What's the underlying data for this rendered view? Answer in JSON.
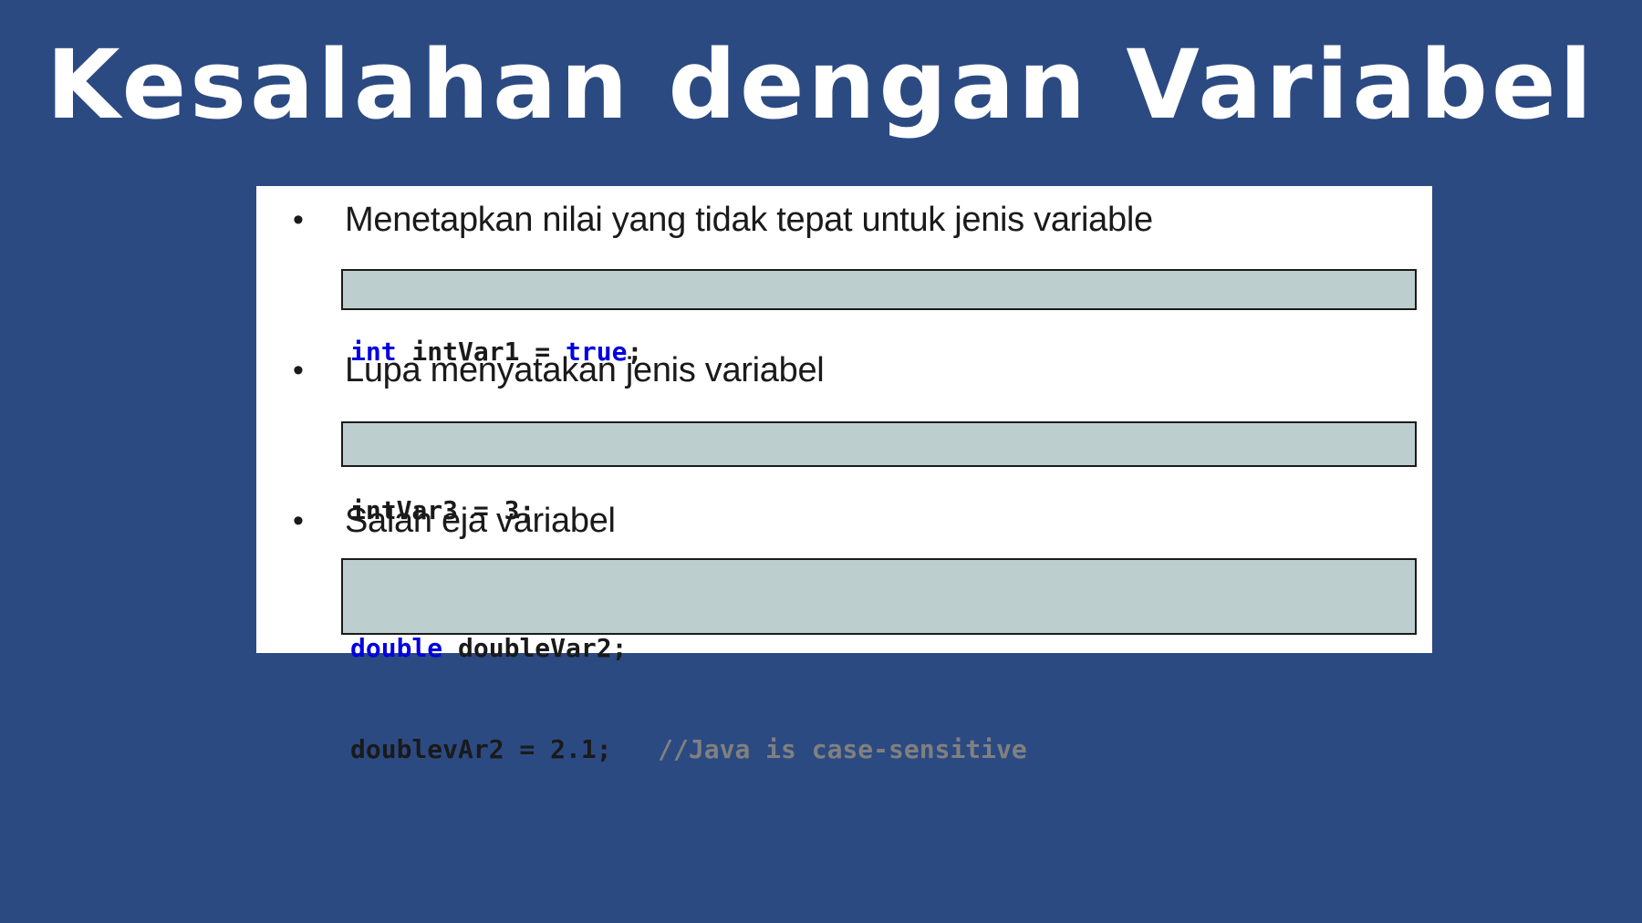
{
  "slide": {
    "title": "Kesalahan dengan Variabel"
  },
  "bullets": [
    {
      "marker": "•",
      "text": "Menetapkan nilai yang tidak tepat untuk jenis variable",
      "code": [
        [
          {
            "text": "int",
            "kind": "keyword"
          },
          {
            "text": " intVar1 = ",
            "kind": "plain"
          },
          {
            "text": "true",
            "kind": "keyword"
          },
          {
            "text": ";",
            "kind": "plain"
          }
        ]
      ]
    },
    {
      "marker": "•",
      "text": "Lupa menyatakan jenis variabel",
      "code": [
        [
          {
            "text": "intVar3 = 3;",
            "kind": "plain"
          }
        ]
      ]
    },
    {
      "marker": "•",
      "text": "Salah eja variabel",
      "code": [
        [
          {
            "text": "double",
            "kind": "keyword"
          },
          {
            "text": " doubleVar2;",
            "kind": "plain"
          }
        ],
        [
          {
            "text": "doublevAr2 = 2.1;   ",
            "kind": "plain"
          },
          {
            "text": "//Java is case-sensitive",
            "kind": "comment"
          }
        ]
      ]
    }
  ],
  "colors": {
    "background": "#2c4a82",
    "panel": "#ffffff",
    "code_background": "#bccece",
    "keyword": "#0000e0",
    "comment": "#808080"
  }
}
